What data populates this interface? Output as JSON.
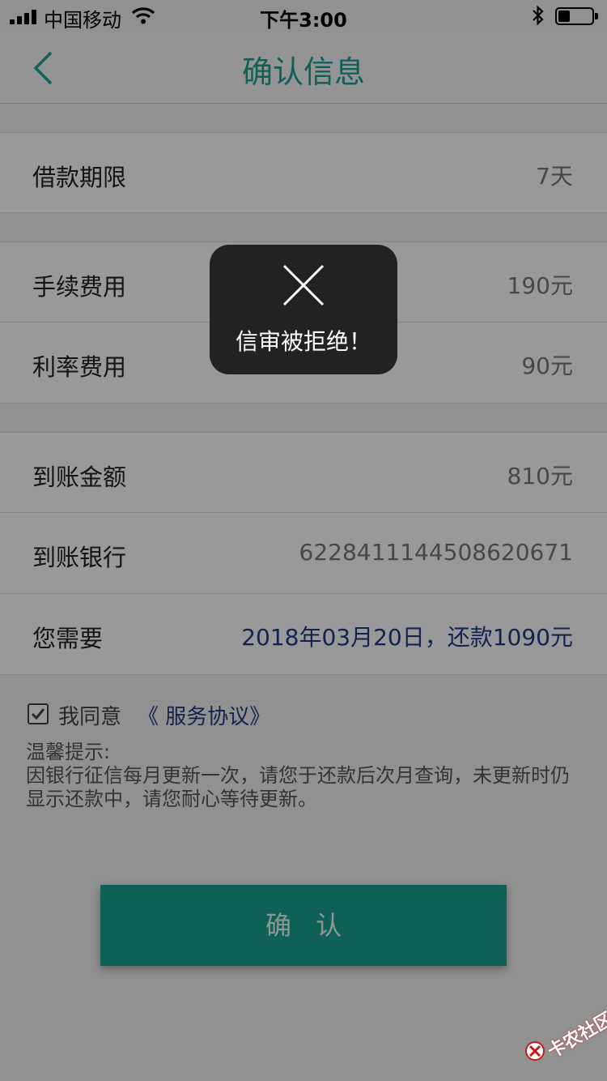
{
  "status_bar": {
    "carrier": "中国移动",
    "time": "下午3:00",
    "battery_level": 0.35
  },
  "nav": {
    "title": "确认信息"
  },
  "rows": [
    {
      "label": "借款期限",
      "value": "7天"
    },
    {
      "label": "手续费用",
      "value": "190元"
    },
    {
      "label": "利率费用",
      "value": "90元"
    },
    {
      "label": "到账金额",
      "value": "810元"
    },
    {
      "label": "到账银行",
      "value": "6228411144508620671"
    },
    {
      "label": "您需要",
      "value": "2018年03月20日，还款1090元"
    }
  ],
  "agreement": {
    "prefix": "我同意",
    "link": "《 服务协议》",
    "checked": true
  },
  "tips": {
    "title": "温馨提示:",
    "body": "因银行征信每月更新一次，请您于还款后次月查询，未更新时仍显示还款中，请您耐心等待更新。"
  },
  "confirm_label": "确认",
  "toast": {
    "message": "信审被拒绝！"
  },
  "watermark": {
    "text": "卡农社区"
  },
  "colors": {
    "accent": "#1aa190",
    "link": "#203b86",
    "toast_bg": "#222222"
  }
}
